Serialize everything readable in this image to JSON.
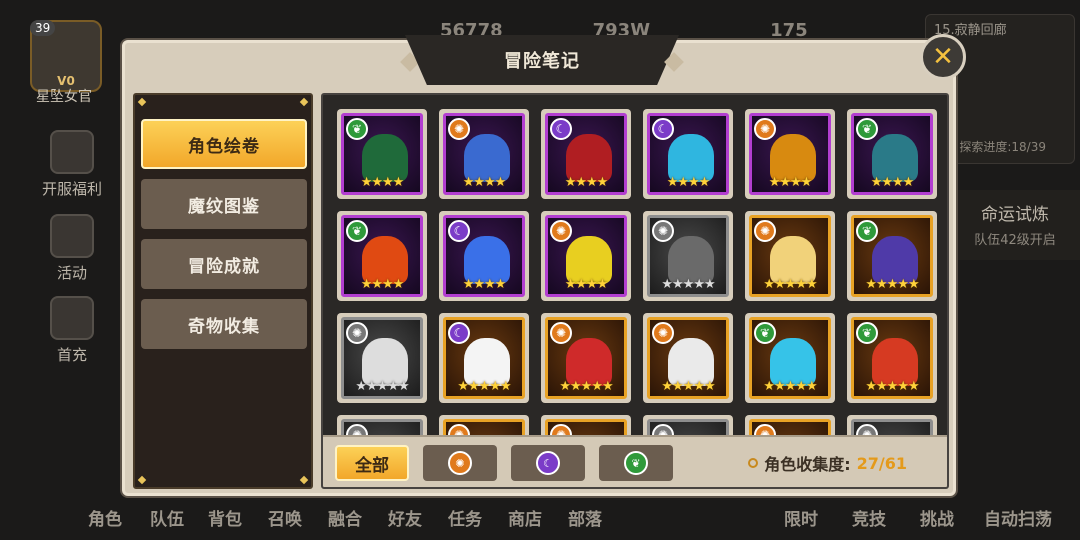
{
  "hud": {
    "player_level": "39",
    "vip": "V0",
    "player_name": "星坠女官",
    "currency_1": "56778",
    "currency_2": "793W",
    "currency_3": "175",
    "stage_title": "15.寂静回廊",
    "stage_progress": "探索进度:18/39",
    "fate_title": "命运试炼",
    "fate_sub": "队伍42级开启",
    "side_buttons": [
      "开服福利",
      "活动",
      "首充"
    ],
    "bottom_nav": [
      "角色",
      "队伍",
      "背包",
      "召唤",
      "融合",
      "好友",
      "任务",
      "商店",
      "部落",
      "限时",
      "竞技",
      "挑战",
      "自动扫荡"
    ]
  },
  "modal": {
    "title": "冒险笔记",
    "close_icon": "✕",
    "menu": [
      "角色绘卷",
      "魔纹图鉴",
      "冒险成就",
      "奇物收集"
    ],
    "filter_all": "全部",
    "collect_label": "角色收集度:",
    "collect_value": "27/61"
  },
  "cards": [
    {
      "frame": "purple",
      "element": "green",
      "stars": "★★★★",
      "color": "#1f6a3a"
    },
    {
      "frame": "purple",
      "element": "orange",
      "stars": "★★★★",
      "color": "#3a6ad0"
    },
    {
      "frame": "purple",
      "element": "purple",
      "stars": "★★★★",
      "color": "#b01e22"
    },
    {
      "frame": "purple",
      "element": "purple",
      "stars": "★★★★",
      "color": "#2fb6e0"
    },
    {
      "frame": "purple",
      "element": "orange",
      "stars": "★★★★",
      "color": "#d88a10"
    },
    {
      "frame": "purple",
      "element": "green",
      "stars": "★★★★",
      "color": "#2a7a88"
    },
    {
      "frame": "purple",
      "element": "green",
      "stars": "★★★★",
      "color": "#e04a12"
    },
    {
      "frame": "purple",
      "element": "purple",
      "stars": "★★★★",
      "color": "#3a70e8"
    },
    {
      "frame": "purple",
      "element": "orange",
      "stars": "★★★★",
      "color": "#e8cf20"
    },
    {
      "frame": "gray",
      "element": "gray",
      "stars": "★★★★★",
      "color": "#6a6a6a"
    },
    {
      "frame": "gold",
      "element": "orange",
      "stars": "★★★★★",
      "color": "#f1d27a"
    },
    {
      "frame": "gold",
      "element": "green",
      "stars": "★★★★★",
      "color": "#4f3aa8"
    },
    {
      "frame": "gray",
      "element": "gray",
      "stars": "★★★★★",
      "color": "#dddddd"
    },
    {
      "frame": "gold",
      "element": "purple",
      "stars": "★★★★★",
      "color": "#f4f4f4"
    },
    {
      "frame": "gold",
      "element": "orange",
      "stars": "★★★★★",
      "color": "#cf2a2a"
    },
    {
      "frame": "gold",
      "element": "orange",
      "stars": "★★★★★",
      "color": "#eaeaea"
    },
    {
      "frame": "gold",
      "element": "green",
      "stars": "★★★★★",
      "color": "#36c3e8"
    },
    {
      "frame": "gold",
      "element": "green",
      "stars": "★★★★★",
      "color": "#d63a22"
    },
    {
      "frame": "gray",
      "element": "gray",
      "stars": "",
      "color": "#777777"
    },
    {
      "frame": "gold",
      "element": "orange",
      "stars": "",
      "color": "#c98a30"
    },
    {
      "frame": "gold",
      "element": "orange",
      "stars": "",
      "color": "#b0702a"
    },
    {
      "frame": "gray",
      "element": "gray",
      "stars": "",
      "color": "#777777"
    },
    {
      "frame": "gold",
      "element": "orange",
      "stars": "",
      "color": "#c98a30"
    },
    {
      "frame": "gray",
      "element": "gray",
      "stars": "",
      "color": "#777777"
    }
  ]
}
